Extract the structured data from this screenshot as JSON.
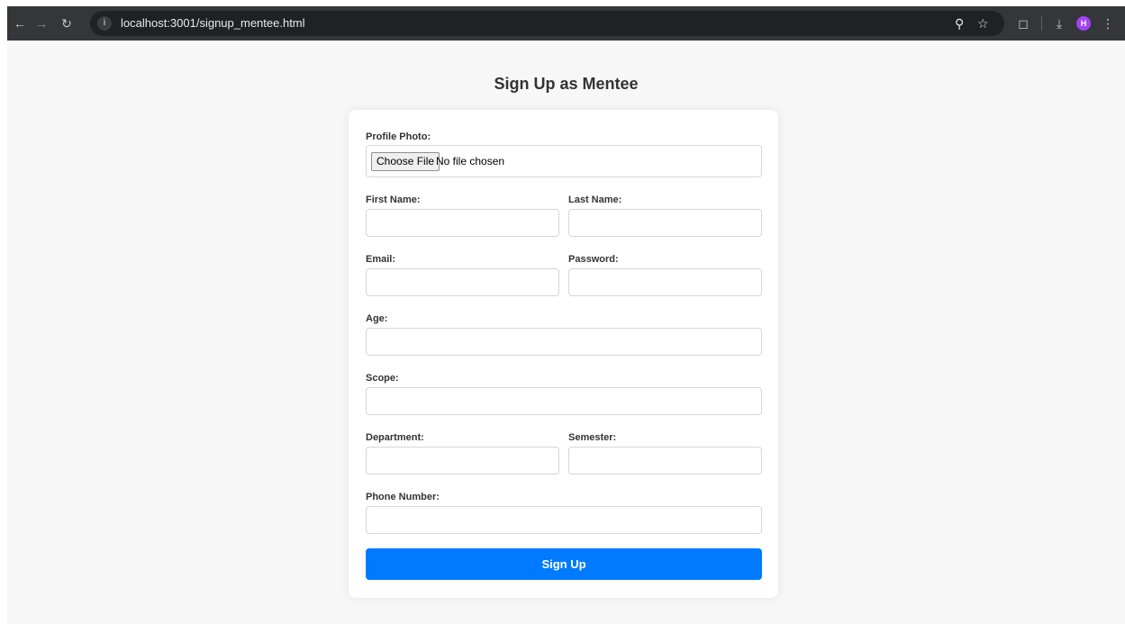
{
  "browser": {
    "back_icon": "arrow-left-icon",
    "forward_icon": "arrow-right-icon",
    "reload_icon": "reload-icon",
    "url": "localhost:3001/signup_mentee.html",
    "avatar_letter": "H"
  },
  "page": {
    "title": "Sign Up as Mentee"
  },
  "form": {
    "profile_photo": {
      "label": "Profile Photo:",
      "button_label": "Choose File",
      "status": "No file chosen"
    },
    "first_name": {
      "label": "First Name:",
      "value": ""
    },
    "last_name": {
      "label": "Last Name:",
      "value": ""
    },
    "email": {
      "label": "Email:",
      "value": ""
    },
    "password": {
      "label": "Password:",
      "value": ""
    },
    "age": {
      "label": "Age:",
      "value": ""
    },
    "scope": {
      "label": "Scope:",
      "value": ""
    },
    "department": {
      "label": "Department:",
      "value": ""
    },
    "semester": {
      "label": "Semester:",
      "value": ""
    },
    "phone": {
      "label": "Phone Number:",
      "value": ""
    },
    "submit_label": "Sign Up"
  },
  "colors": {
    "toolbar": "#35363a",
    "page_background": "#f7f7f7",
    "primary_button": "#007bff",
    "avatar": "#a142f4"
  }
}
